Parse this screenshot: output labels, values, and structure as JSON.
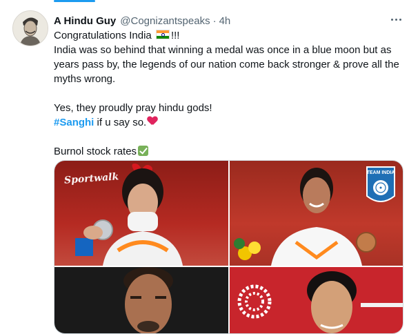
{
  "tweet": {
    "author_name": "A Hindu Guy",
    "handle": "@Cognizantspeaks",
    "separator": "·",
    "time": "4h",
    "line1_before_flag": "Congratulations India",
    "line1_after_flag": "!!!",
    "paragraph1": "India was so behind that winning a medal was once in a blue moon but as years pass by, the legends of our nation come back stronger & prove all the myths wrong.",
    "paragraph2_line1": "Yes, they proudly pray hindu gods!",
    "hashtag": "#Sanghi",
    "paragraph2_line2_rest": " if u say so.",
    "paragraph3": "Burnol stock rates"
  },
  "media": {
    "watermark": "Sportwalk",
    "team_badge_text": "TEAM INDIA"
  },
  "icons": {
    "flag": "india-flag-icon",
    "heart": "red-heart-icon",
    "check": "check-mark-icon",
    "more": "more-options-icon"
  },
  "colors": {
    "link": "#1d9bf0",
    "secondary_text": "#536471",
    "heart": "#e0245e",
    "check": "#78b159"
  }
}
